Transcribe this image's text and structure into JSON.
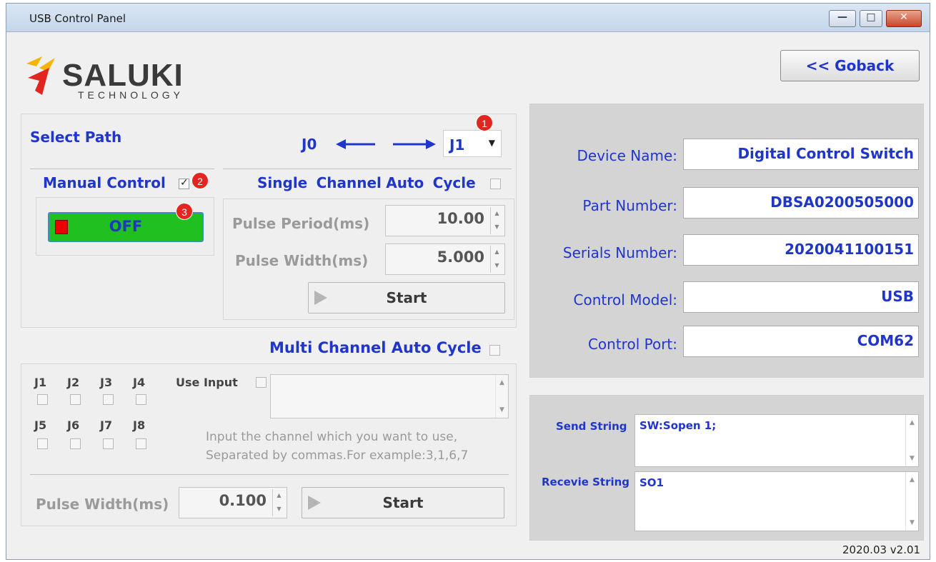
{
  "window": {
    "title": "USB Control Panel"
  },
  "logo": {
    "brand": "SALUKI",
    "sub": "TECHNOLOGY"
  },
  "goback_label": "<< Goback",
  "path": {
    "label": "Select Path",
    "from": "J0",
    "to": "J1"
  },
  "manual": {
    "label": "Manual Control",
    "checked": true,
    "toggle_label": "OFF",
    "toggle_color": "#1fc01f"
  },
  "single": {
    "label_parts": [
      "Single",
      "Channel",
      "Auto",
      "Cycle"
    ],
    "period_label": "Pulse Period(ms)",
    "period_value": "10.00",
    "width_label": "Pulse Width(ms)",
    "width_value": "5.000",
    "start_label": "Start"
  },
  "multi": {
    "label": "Multi Channel Auto Cycle",
    "channels_row1": [
      "J1",
      "J2",
      "J3",
      "J4"
    ],
    "channels_row2": [
      "J5",
      "J6",
      "J7",
      "J8"
    ],
    "use_input_label": "Use Input",
    "hint_line1": "Input the channel which you want to use,",
    "hint_line2": "Separated by commas.For example:3,1,6,7",
    "width_label": "Pulse Width(ms)",
    "width_value": "0.100",
    "start_label": "Start"
  },
  "badges": [
    "1",
    "2",
    "3"
  ],
  "device": {
    "rows": [
      {
        "label": "Device Name:",
        "value": "Digital Control Switch"
      },
      {
        "label": "Part Number:",
        "value": "DBSA0200505000"
      },
      {
        "label": "Serials Number:",
        "value": "2020041100151"
      },
      {
        "label": "Control Model:",
        "value": "USB"
      },
      {
        "label": "Control Port:",
        "value": "COM62"
      }
    ]
  },
  "io": {
    "send_label": "Send String",
    "send_value": "SW:Sopen 1;",
    "recv_label": "Recevie String",
    "recv_value": "SO1"
  },
  "version": "2020.03 v2.01",
  "colors": {
    "accent": "#2036c9",
    "badge": "#e2261f",
    "logo_red": "#e2261f",
    "logo_yellow": "#f4b400"
  }
}
